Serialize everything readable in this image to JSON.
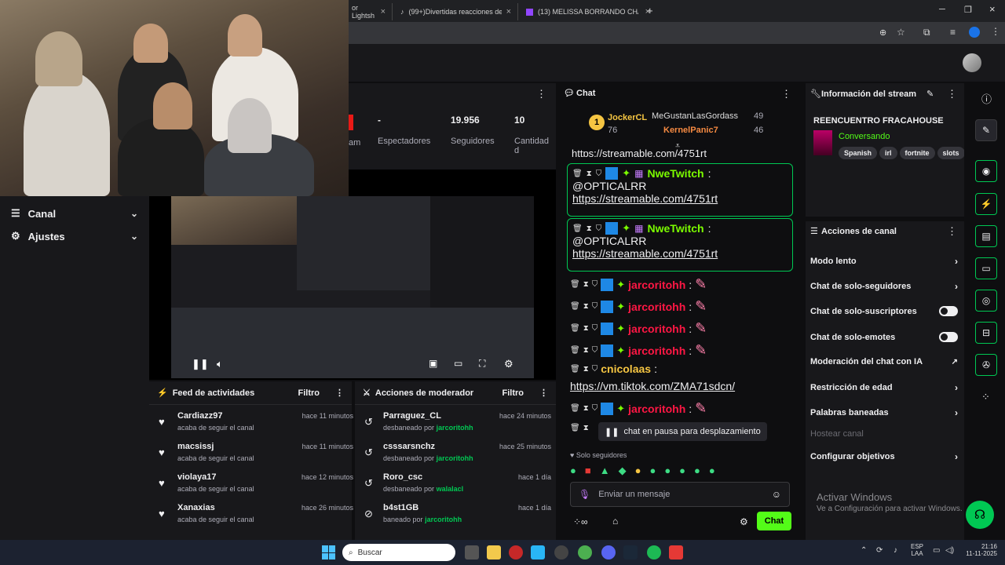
{
  "browser": {
    "tabs": [
      {
        "label": "or Lightsh"
      },
      {
        "label": "(99+)Divertidas reacciones de S"
      },
      {
        "label": "(13) MELISSA BORRANDO CHA"
      }
    ],
    "new_tab": "+"
  },
  "nav": {
    "canal": "Canal",
    "ajustes": "Ajustes"
  },
  "stats": {
    "dash": "-",
    "espectadores_label": "Espectadores",
    "seguidores_value": "19.956",
    "seguidores_label": "Seguidores",
    "cantidad_value": "10",
    "cantidad_label": "Cantidad d",
    "am_label": "am"
  },
  "feed": {
    "title": "Feed de actividades",
    "filter": "Filtro",
    "items": [
      {
        "name": "Cardiazz97",
        "sub": "acaba de seguir el canal",
        "time": "hace 11 minutos"
      },
      {
        "name": "macsissj",
        "sub": "acaba de seguir el canal",
        "time": "hace 11 minutos"
      },
      {
        "name": "violaya17",
        "sub": "acaba de seguir el canal",
        "time": "hace 12 minutos"
      },
      {
        "name": "Xanaxias",
        "sub": "acaba de seguir el canal",
        "time": "hace 26 minutos"
      }
    ]
  },
  "mod": {
    "title": "Acciones de moderador",
    "filter": "Filtro",
    "items": [
      {
        "name": "Parraguez_CL",
        "action": "desbaneado por",
        "by": "jarcoritohh",
        "time": "hace 24 minutos"
      },
      {
        "name": "csssarsnchz",
        "action": "desbaneado por",
        "by": "jarcoritohh",
        "time": "hace 25 minutos"
      },
      {
        "name": "Roro_csc",
        "action": "desbaneado por",
        "by": "walalacl",
        "time": "hace 1 día"
      },
      {
        "name": "b4st1GB",
        "action": "baneado por",
        "by": "jarcoritohh",
        "time": "hace 1 día"
      }
    ]
  },
  "chat": {
    "title": "Chat",
    "leader": {
      "rank": "1",
      "name": "JockerCL",
      "count": "76"
    },
    "top2": {
      "name": "MeGustanLasGordass",
      "count": "49"
    },
    "top3": {
      "name": "KernelPanic7",
      "count": "46"
    },
    "partial_link": "https://streamable.com/4751rt",
    "boxed": [
      {
        "user": "NweTwitch",
        "text": "@OPTICALRR",
        "link": "https://streamable.com/4751rt"
      },
      {
        "user": "NweTwitch",
        "text": "@OPTICALRR",
        "link": "https://streamable.com/4751rt"
      }
    ],
    "red_user": "jarcoritohh",
    "cnicolaas": "cnicolaas",
    "tiktok": "https://vm.tiktok.com/ZMA71sdcn/",
    "paused": "chat en pausa para desplazamiento",
    "followers_only": "Solo seguidores",
    "placeholder": "Enviar un mensaje",
    "send": "Chat"
  },
  "info": {
    "title": "Información del stream",
    "stream_title": "REENCUENTRO FRACAHOUSE",
    "category": "Conversando",
    "tags": [
      "Spanish",
      "irl",
      "fortnite",
      "slots"
    ]
  },
  "actions": {
    "title": "Acciones de canal",
    "items": [
      {
        "label": "Modo lento",
        "type": "chevron"
      },
      {
        "label": "Chat de solo-seguidores",
        "type": "chevron"
      },
      {
        "label": "Chat de solo-suscriptores",
        "type": "toggle"
      },
      {
        "label": "Chat de solo-emotes",
        "type": "toggle"
      },
      {
        "label": "Moderación del chat con IA",
        "type": "external"
      },
      {
        "label": "Restricción de edad",
        "type": "chevron"
      },
      {
        "label": "Palabras baneadas",
        "type": "chevron"
      },
      {
        "label": "Hostear canal",
        "type": "disabled"
      },
      {
        "label": "Configurar objetivos",
        "type": "chevron"
      }
    ]
  },
  "windows": {
    "activate": "Activar Windows",
    "activate_sub": "Ve a Configuración para activar Windows."
  },
  "taskbar": {
    "search": "Buscar",
    "lang": "ESP",
    "lang2": "LAA",
    "time": "21:16",
    "date": "11-11-2025"
  },
  "colors": {
    "accent": "#00c853",
    "red_user": "#ff1744",
    "green_user": "#7cfc00"
  }
}
